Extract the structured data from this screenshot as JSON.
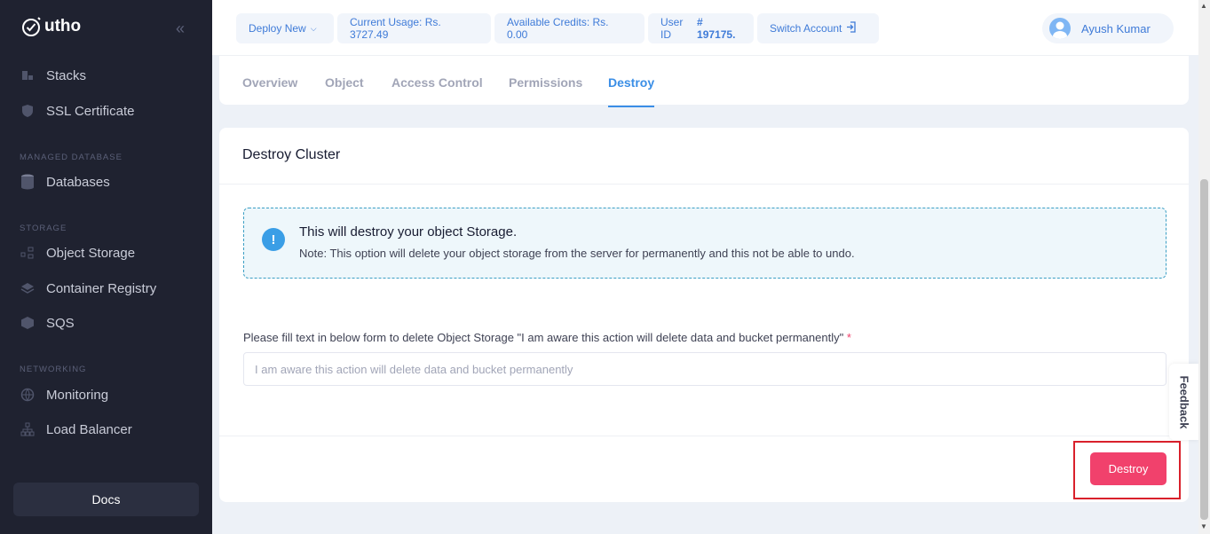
{
  "brand": {
    "name": "utho"
  },
  "sidebar": {
    "items": [
      {
        "label": "Stacks",
        "icon": "stacks-icon"
      },
      {
        "label": "SSL Certificate",
        "icon": "shield-icon"
      },
      {
        "section": "MANAGED DATABASE"
      },
      {
        "label": "Databases",
        "icon": "database-icon"
      },
      {
        "section": "STORAGE"
      },
      {
        "label": "Object Storage",
        "icon": "object-storage-icon"
      },
      {
        "label": "Container Registry",
        "icon": "layers-icon"
      },
      {
        "label": "SQS",
        "icon": "cube-icon"
      },
      {
        "section": "NETWORKING"
      },
      {
        "label": "Monitoring",
        "icon": "globe-icon"
      },
      {
        "label": "Load Balancer",
        "icon": "network-icon"
      }
    ],
    "docs": "Docs"
  },
  "topbar": {
    "deploy": "Deploy New",
    "usage": "Current Usage: Rs. 3727.49",
    "credits": "Available Credits: Rs. 0.00",
    "user_id_label": "User ID",
    "user_id": "# 197175.",
    "switch_account": "Switch Account",
    "user_name": "Ayush Kumar"
  },
  "tabs": [
    {
      "label": "Overview"
    },
    {
      "label": "Object"
    },
    {
      "label": "Access Control"
    },
    {
      "label": "Permissions"
    },
    {
      "label": "Destroy",
      "active": true
    }
  ],
  "card": {
    "title": "Destroy Cluster",
    "alert_title": "This will destroy your object Storage.",
    "alert_note": "Note: This option will delete your object storage from the server for permanently and this not be able to undo.",
    "form_label": "Please fill text in below form to delete Object Storage \"I am aware this action will delete data and bucket permanently\"",
    "required_mark": "*",
    "input_placeholder": "I am aware this action will delete data and bucket permanently",
    "input_value": "",
    "destroy_label": "Destroy"
  },
  "feedback": "Feedback",
  "colors": {
    "accent": "#3a8ee6",
    "danger": "#f1416c",
    "sidebar_bg": "#1f2230"
  }
}
